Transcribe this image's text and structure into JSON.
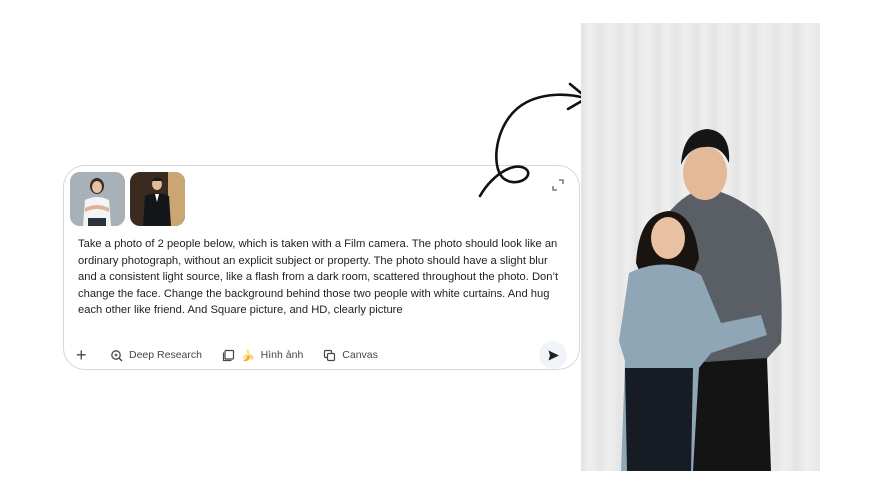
{
  "prompt": {
    "text": "Take a photo of 2 people below, which is taken with a Film camera. The photo should look like an ordinary photograph, without an explicit subject or property. The photo should have a slight blur and a consistent light source, like a flash from a dark room, scattered throughout the photo. Don’t change the face. Change the background behind those two people with white curtains. And hug each other like friend. And Square picture, and HD, clearly picture",
    "attachments": [
      "woman-portrait-thumbnail",
      "man-portrait-thumbnail"
    ]
  },
  "toolbar": {
    "add_icon": "+",
    "deep_research_label": "Deep Research",
    "image_label": "Hình ảnh",
    "image_emoji": "🍌",
    "canvas_label": "Canvas"
  },
  "colors": {
    "card_border": "#d6d6d6",
    "toolbar_text": "#444746",
    "send_bg": "#f0f4f9",
    "curtain": "#e9e9e9"
  },
  "icons": [
    "plus-icon",
    "deep-research-icon",
    "image-stack-icon",
    "banana-icon",
    "canvas-icon",
    "send-icon",
    "expand-icon",
    "curved-arrow"
  ]
}
